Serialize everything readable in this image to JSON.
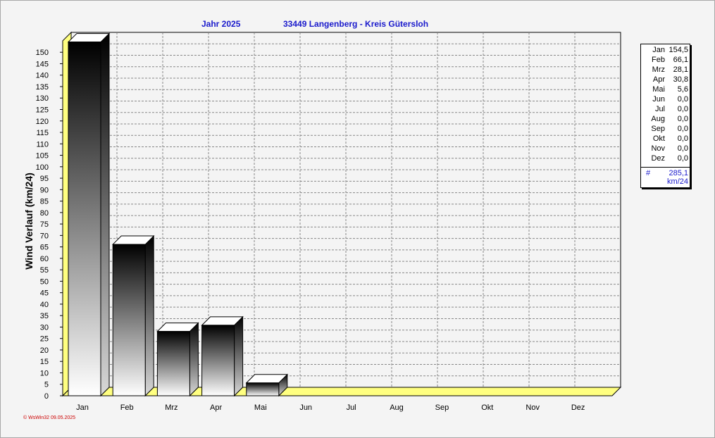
{
  "title": {
    "year": "Jahr  2025",
    "location": "33449 Langenberg - Kreis Gütersloh"
  },
  "chart_data": {
    "type": "bar",
    "title": "Jahr  2025     33449 Langenberg - Kreis Gütersloh",
    "ylabel": "Wind Verlauf  (km/24)",
    "xlabel": "",
    "categories": [
      "Jan",
      "Feb",
      "Mrz",
      "Apr",
      "Mai",
      "Jun",
      "Jul",
      "Aug",
      "Sep",
      "Okt",
      "Nov",
      "Dez"
    ],
    "values": [
      154.5,
      66.1,
      28.1,
      30.8,
      5.6,
      0.0,
      0.0,
      0.0,
      0.0,
      0.0,
      0.0,
      0.0
    ],
    "ylim": [
      0,
      155
    ],
    "yticks": [
      0,
      5,
      10,
      15,
      20,
      25,
      30,
      35,
      40,
      45,
      50,
      55,
      60,
      65,
      70,
      75,
      80,
      85,
      90,
      95,
      100,
      105,
      110,
      115,
      120,
      125,
      130,
      135,
      140,
      145,
      150
    ],
    "grid": true,
    "legend_position": "right"
  },
  "legend": {
    "rows": [
      {
        "month": "Jan",
        "value": "154,5"
      },
      {
        "month": "Feb",
        "value": "66,1"
      },
      {
        "month": "Mrz",
        "value": "28,1"
      },
      {
        "month": "Apr",
        "value": "30,8"
      },
      {
        "month": "Mai",
        "value": "5,6"
      },
      {
        "month": "Jun",
        "value": "0,0"
      },
      {
        "month": "Jul",
        "value": "0,0"
      },
      {
        "month": "Aug",
        "value": "0,0"
      },
      {
        "month": "Sep",
        "value": "0,0"
      },
      {
        "month": "Okt",
        "value": "0,0"
      },
      {
        "month": "Nov",
        "value": "0,0"
      },
      {
        "month": "Dez",
        "value": "0,0"
      }
    ],
    "total_symbol": "#",
    "total": "285,1",
    "unit": "km/24"
  },
  "footer": "© WsWin32  09.05.2025",
  "colors": {
    "title": "#1a1acc",
    "floor": "#ffff80",
    "grid": "#888888",
    "footer": "#cc0000"
  }
}
